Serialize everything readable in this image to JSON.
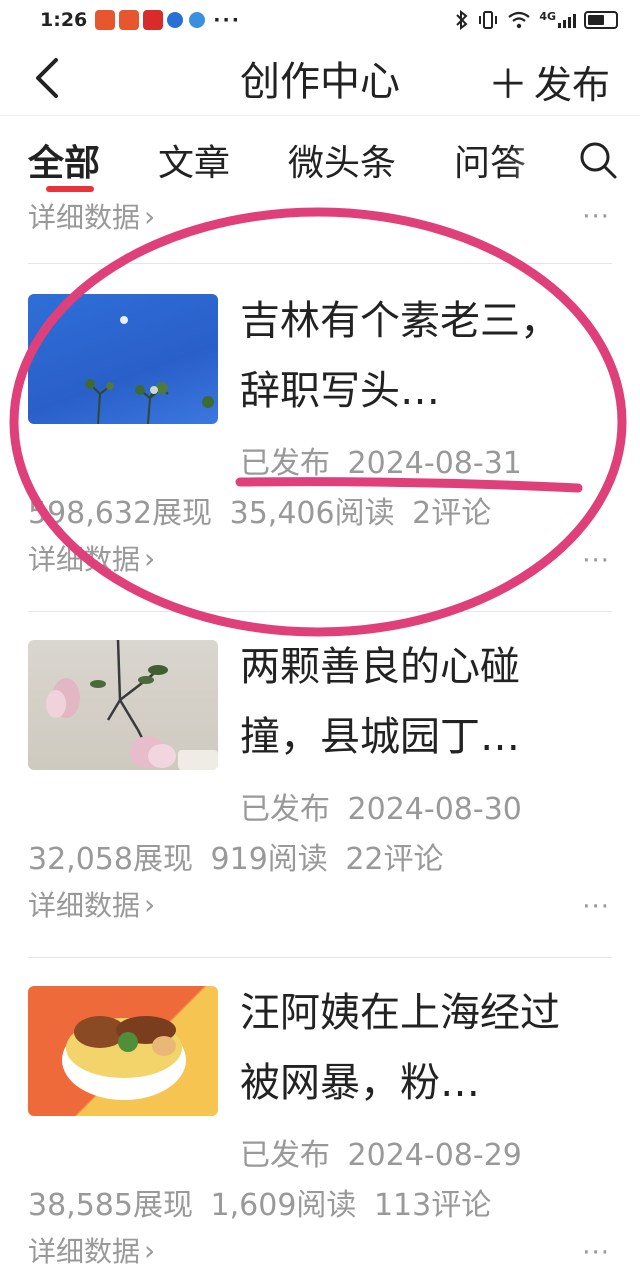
{
  "status_bar": {
    "time": "1:26",
    "more_dots": "···",
    "network": "4G",
    "battery_level": 0.6
  },
  "header": {
    "title": "创作中心",
    "publish_label": "发布"
  },
  "tabs": [
    {
      "label": "全部",
      "active": true
    },
    {
      "label": "文章",
      "active": false
    },
    {
      "label": "微头条",
      "active": false
    },
    {
      "label": "问答",
      "active": false
    }
  ],
  "accent_color": "#e8333a",
  "annotation_color": "#e0407a",
  "partial_row": {
    "details_label": "详细数据",
    "more_label": "···"
  },
  "articles": [
    {
      "title": "吉林有个素老三，辞职写头…",
      "status": "已发布",
      "date": "2024-08-31",
      "impressions": "598,632展现",
      "reads": "35,406阅读",
      "comments": "2评论",
      "details_label": "详细数据",
      "more_label": "···"
    },
    {
      "title": "两颗善良的心碰撞，县城园丁…",
      "status": "已发布",
      "date": "2024-08-30",
      "impressions": "32,058展现",
      "reads": "919阅读",
      "comments": "22评论",
      "details_label": "详细数据",
      "more_label": "···"
    },
    {
      "title": "汪阿姨在上海经过被网暴，粉…",
      "status": "已发布",
      "date": "2024-08-29",
      "impressions": "38,585展现",
      "reads": "1,609阅读",
      "comments": "113评论",
      "details_label": "详细数据",
      "more_label": "···"
    }
  ]
}
